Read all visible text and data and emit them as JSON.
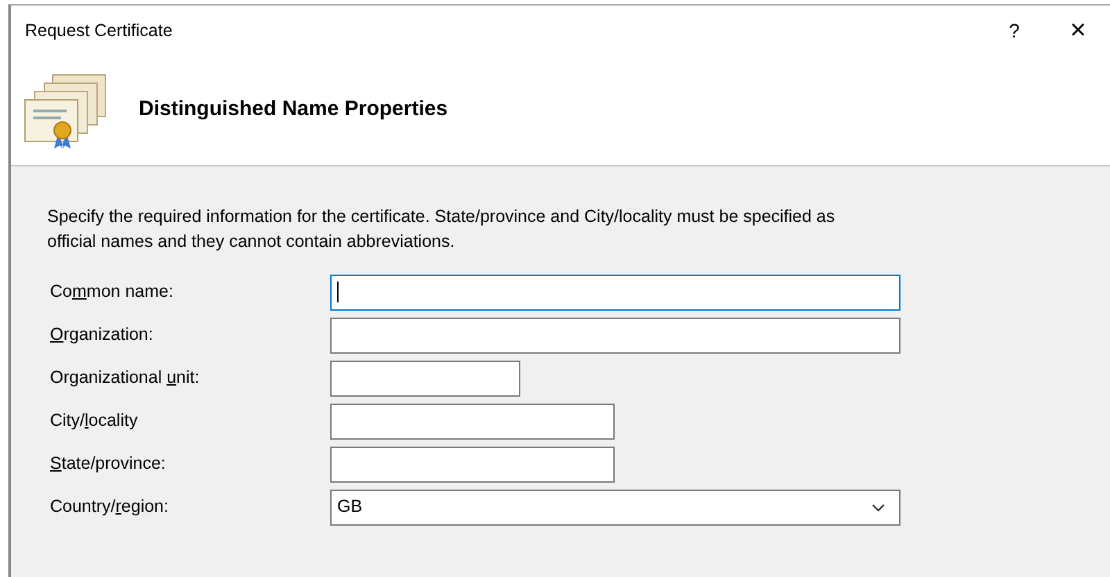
{
  "window": {
    "title": "Request Certificate",
    "help_glyph": "?",
    "close_glyph": "×"
  },
  "header": {
    "title": "Distinguished Name Properties"
  },
  "description": "Specify the required information for the certificate. State/province and City/locality must be specified as official names and they cannot contain abbreviations.",
  "fields": [
    {
      "label": {
        "before": "Co",
        "key": "m",
        "after": "mon name:"
      },
      "kind": "text",
      "focused": true
    },
    {
      "label": {
        "key": "O",
        "after": "rganization:"
      },
      "kind": "text",
      "focused": false
    },
    {
      "label": {
        "before": "Organizational ",
        "key": "u",
        "after": "nit:"
      },
      "kind": "text",
      "focused": false
    },
    {
      "label": {
        "before": "City/",
        "key": "l",
        "after": "ocality"
      },
      "kind": "text",
      "focused": false
    },
    {
      "label": {
        "key": "S",
        "after": "tate/province:"
      },
      "kind": "text",
      "focused": false
    },
    {
      "label": {
        "before": "Country/",
        "key": "r",
        "after": "egion:"
      },
      "kind": "dropdown",
      "value": "GB",
      "focused": false
    }
  ]
}
